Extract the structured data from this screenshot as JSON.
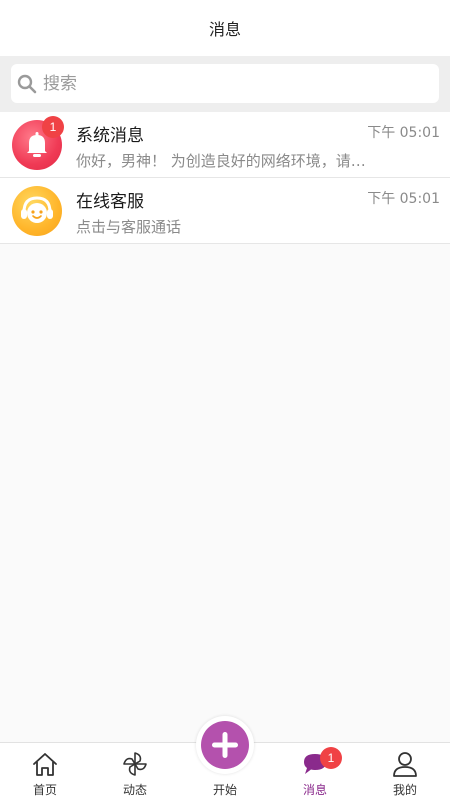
{
  "header": {
    "title": "消息"
  },
  "search": {
    "placeholder": "搜索",
    "icon": "search-icon"
  },
  "messages": [
    {
      "name": "系统消息",
      "preview": "你好，男神！ 为创造良好的网络环境，请遵守平台规范",
      "time": "下午 05:01",
      "badge": "1",
      "icon": "bell-icon"
    },
    {
      "name": "在线客服",
      "preview": "点击与客服通话",
      "time": "下午 05:01",
      "icon": "customer-service-icon"
    }
  ],
  "tabbar": {
    "items": [
      {
        "label": "首页",
        "icon": "home-icon"
      },
      {
        "label": "动态",
        "icon": "pinwheel-icon"
      },
      {
        "label": "开始",
        "icon": "plus-icon"
      },
      {
        "label": "消息",
        "icon": "chat-bubble-icon",
        "badge": "1",
        "active": true
      },
      {
        "label": "我的",
        "icon": "user-icon"
      }
    ]
  },
  "colors": {
    "accent": "#b451ad",
    "active_tab": "#8a2a8c",
    "badge": "#f04245",
    "system_avatar": "#f03a55",
    "service_avatar": "#ffb52a"
  }
}
